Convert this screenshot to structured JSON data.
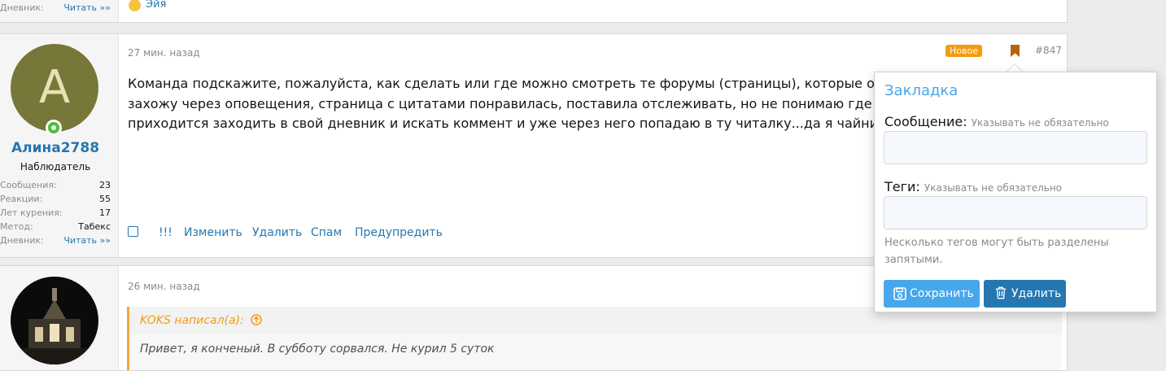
{
  "post_prev": {
    "stat_label": "Дневник:",
    "stat_value": "Читать »»",
    "reaction_name": "Эйя"
  },
  "post_main": {
    "avatar_letter": "A",
    "username": "Алина2788",
    "user_title": "Наблюдатель",
    "stats": [
      {
        "label": "Сообщения:",
        "value": "23"
      },
      {
        "label": "Реакции:",
        "value": "55"
      },
      {
        "label": "Лет курения:",
        "value": "17"
      },
      {
        "label": "Метод:",
        "value": "Табекс"
      },
      {
        "label": "Дневник:",
        "value": "Читать »»"
      }
    ],
    "time": "27 мин. назад",
    "badge": "Новое",
    "post_number": "#847",
    "text_lines": [
      "Команда подскажите, пожалуйста, как сделать или где можно смотреть те форумы (страницы), которые отслеж",
      "захожу через оповещения, страница с цитатами понравилась, поставила отслеживать, но не понимаю где в пр",
      "приходится заходить в свой дневник и искать коммент и уже через него попадаю в ту читалку...да я чайник =)"
    ],
    "actions": {
      "report": "!!!",
      "edit": "Изменить",
      "delete": "Удалить",
      "spam": "Спам",
      "warn": "Предупредить"
    }
  },
  "post_next": {
    "time": "26 мин. назад",
    "quote_author": "KOKS написал(а):",
    "quote_text": "Привет, я конченый. В субботу сорвался. Не курил 5 суток"
  },
  "bookmark_popup": {
    "title": "Закладка",
    "message_label": "Сообщение:",
    "message_hint": "Указывать не обязательно",
    "tags_label": "Теги:",
    "tags_hint": "Указывать не обязательно",
    "tags_note": "Несколько тегов могут быть разделены запятыми.",
    "save_label": "Сохранить",
    "delete_label": "Удалить"
  },
  "colors": {
    "link": "#2577b1",
    "accent_light": "#47a7eb",
    "badge": "#f39c12",
    "online": "#4fbf3f"
  }
}
